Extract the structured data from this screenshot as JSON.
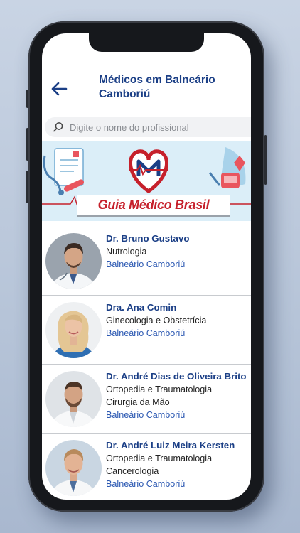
{
  "header": {
    "title": "Médicos em Balneário Camboriú",
    "back_icon": "arrow-left-icon"
  },
  "search": {
    "placeholder": "Digite o nome do profissional",
    "value": ""
  },
  "banner": {
    "title": "Guia Médico Brasil",
    "logo_letter": "M"
  },
  "colors": {
    "primary": "#1b3f86",
    "link": "#2b58b2",
    "banner_red": "#c6202b",
    "banner_bg": "#dbeef8"
  },
  "doctors": [
    {
      "name": "Dr. Bruno Gustavo",
      "specialties": [
        "Nutrologia"
      ],
      "city": "Balneário Camboriú"
    },
    {
      "name": "Dra. Ana Comin",
      "specialties": [
        "Ginecologia e Obstetrícia"
      ],
      "city": "Balneário Camboriú"
    },
    {
      "name": "Dr. André Dias de Oliveira Brito",
      "specialties": [
        "Ortopedia e Traumatologia",
        "Cirurgia da Mão"
      ],
      "city": "Balneário Camboriú"
    },
    {
      "name": "Dr. André Luiz Meira Kersten",
      "specialties": [
        "Ortopedia e Traumatologia",
        "Cancerologia"
      ],
      "city": "Balneário Camboriú"
    }
  ]
}
